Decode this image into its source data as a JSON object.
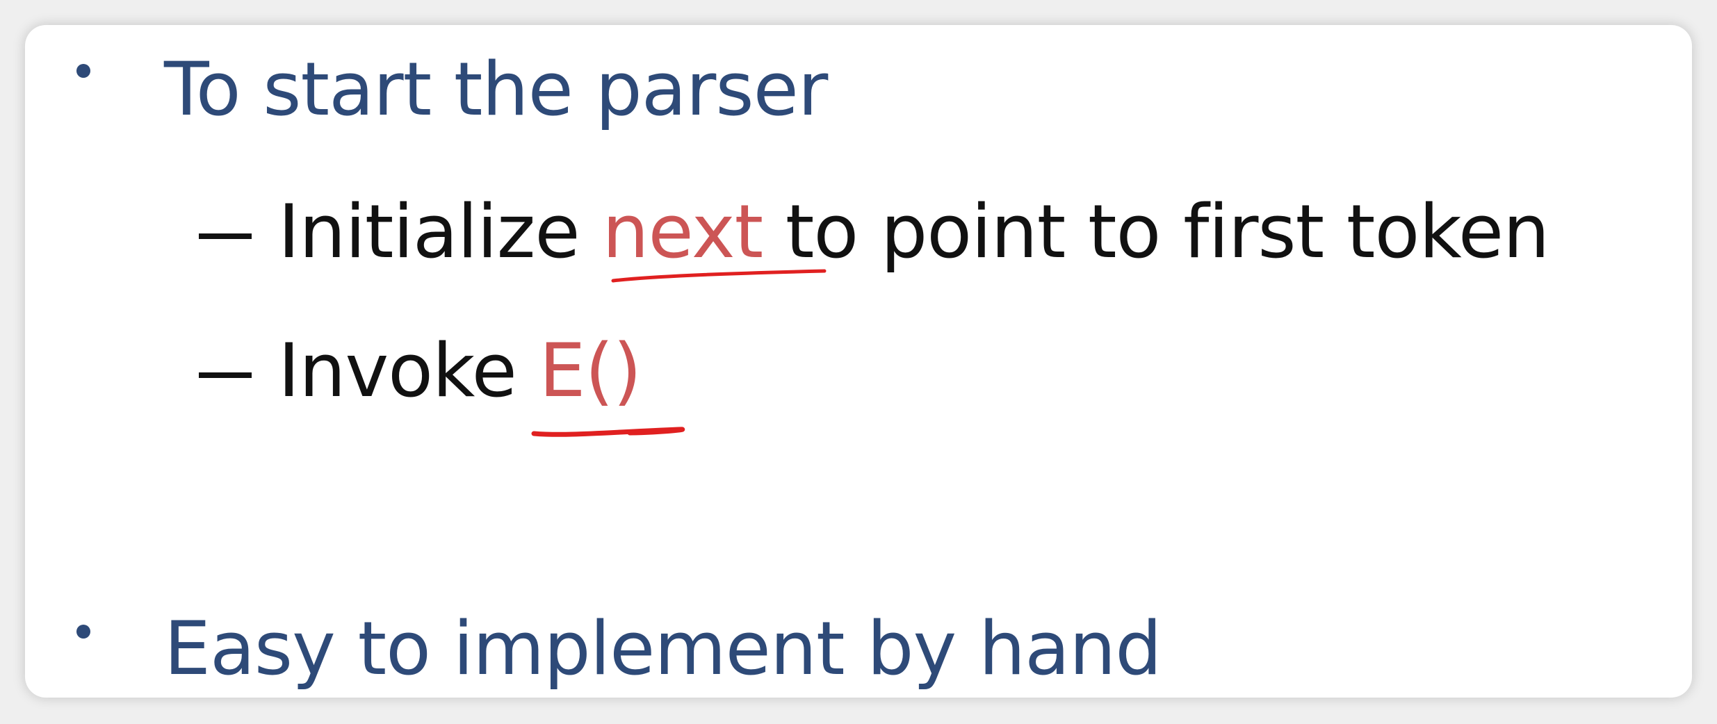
{
  "slide": {
    "bullets": [
      {
        "text": "To start the parser",
        "sub_items": [
          {
            "prefix": "Initialize ",
            "highlight": "next",
            "suffix": " to point to first token"
          },
          {
            "prefix": "Invoke ",
            "highlight": "E()",
            "suffix": ""
          }
        ]
      },
      {
        "text": "Easy to implement by hand",
        "sub_items": []
      }
    ]
  },
  "colors": {
    "bullet_text": "#2e4a78",
    "sub_text": "#111111",
    "highlight": "#cc5555",
    "annotation_ink": "#e02020"
  }
}
